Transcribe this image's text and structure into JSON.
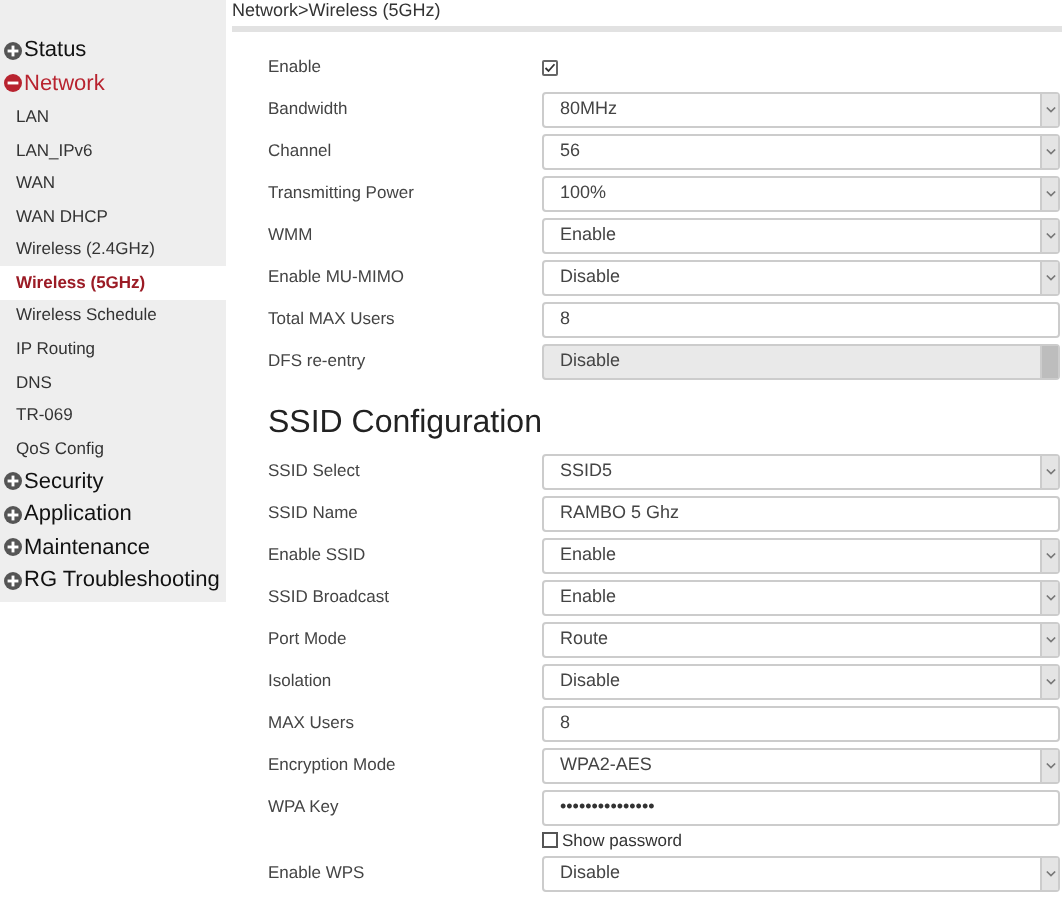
{
  "sidebar": {
    "sections": [
      {
        "label": "Status",
        "expanded": false
      },
      {
        "label": "Network",
        "expanded": true,
        "children": [
          {
            "label": "LAN",
            "selected": false
          },
          {
            "label": "LAN_IPv6",
            "selected": false
          },
          {
            "label": "WAN",
            "selected": false
          },
          {
            "label": "WAN DHCP",
            "selected": false
          },
          {
            "label": "Wireless (2.4GHz)",
            "selected": false
          },
          {
            "label": "Wireless (5GHz)",
            "selected": true
          },
          {
            "label": "Wireless Schedule",
            "selected": false
          },
          {
            "label": "IP Routing",
            "selected": false
          },
          {
            "label": "DNS",
            "selected": false
          },
          {
            "label": "TR-069",
            "selected": false
          },
          {
            "label": "QoS Config",
            "selected": false
          }
        ]
      },
      {
        "label": "Security",
        "expanded": false
      },
      {
        "label": "Application",
        "expanded": false
      },
      {
        "label": "Maintenance",
        "expanded": false
      },
      {
        "label": "RG Troubleshooting",
        "expanded": false
      }
    ]
  },
  "breadcrumb": "Network>Wireless (5GHz)",
  "wireless_rows": [
    {
      "kind": "checkbox",
      "label": "Enable",
      "checked": true
    },
    {
      "kind": "select",
      "label": "Bandwidth",
      "value": "80MHz",
      "disabled": false
    },
    {
      "kind": "select",
      "label": "Channel",
      "value": "56",
      "disabled": false
    },
    {
      "kind": "select",
      "label": "Transmitting Power",
      "value": "100%",
      "disabled": false
    },
    {
      "kind": "select",
      "label": "WMM",
      "value": "Enable",
      "disabled": false
    },
    {
      "kind": "select",
      "label": "Enable MU-MIMO",
      "value": "Disable",
      "disabled": false
    },
    {
      "kind": "input",
      "label": "Total MAX Users",
      "value": "8"
    },
    {
      "kind": "select",
      "label": "DFS re-entry",
      "value": "Disable",
      "disabled": true
    }
  ],
  "ssid_heading": "SSID Configuration",
  "ssid_rows": [
    {
      "kind": "select",
      "label": "SSID Select",
      "value": "SSID5",
      "disabled": false
    },
    {
      "kind": "input",
      "label": "SSID Name",
      "value": "RAMBO 5 Ghz"
    },
    {
      "kind": "select",
      "label": "Enable SSID",
      "value": "Enable",
      "disabled": false
    },
    {
      "kind": "select",
      "label": "SSID Broadcast",
      "value": "Enable",
      "disabled": false
    },
    {
      "kind": "select",
      "label": "Port Mode",
      "value": "Route",
      "disabled": false
    },
    {
      "kind": "select",
      "label": "Isolation",
      "value": "Disable",
      "disabled": false
    },
    {
      "kind": "input",
      "label": "MAX Users",
      "value": "8"
    },
    {
      "kind": "select",
      "label": "Encryption Mode",
      "value": "WPA2-AES",
      "disabled": false
    },
    {
      "kind": "password",
      "label": "WPA Key",
      "value": "•••••••••••••••",
      "show_label": "Show password",
      "show_checked": false
    },
    {
      "kind": "select",
      "label": "Enable WPS",
      "value": "Disable",
      "disabled": false
    }
  ]
}
